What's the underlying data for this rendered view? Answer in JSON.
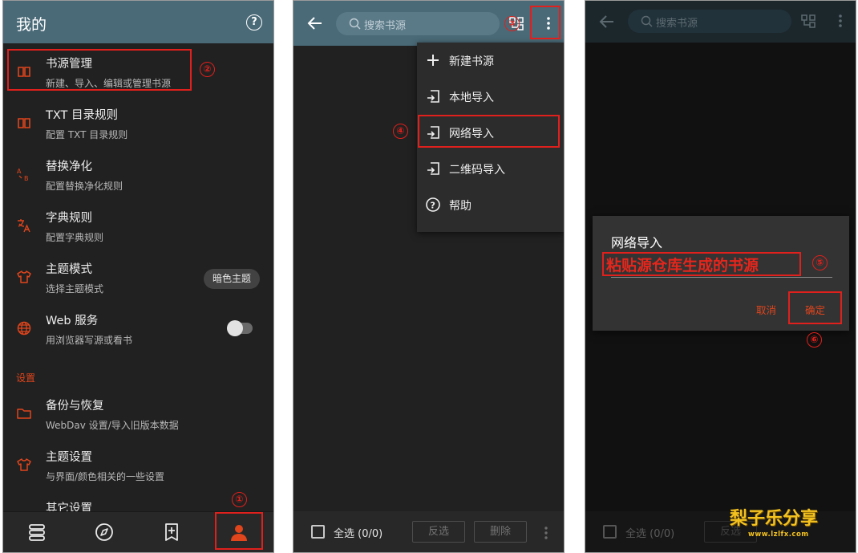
{
  "panel1": {
    "title": "我的",
    "rows": [
      {
        "title": "书源管理",
        "sub": "新建、导入、编辑或管理书源"
      },
      {
        "title": "TXT 目录规则",
        "sub": "配置 TXT 目录规则"
      },
      {
        "title": "替换净化",
        "sub": "配置替换净化规则"
      },
      {
        "title": "字典规则",
        "sub": "配置字典规则"
      },
      {
        "title": "主题模式",
        "sub": "选择主题模式"
      },
      {
        "title": "Web 服务",
        "sub": "用浏览器写源或看书"
      }
    ],
    "theme_chip": "暗色主题",
    "section_label": "设置",
    "settings_rows": [
      {
        "title": "备份与恢复",
        "sub": "WebDav 设置/导入旧版本数据"
      },
      {
        "title": "主题设置",
        "sub": "与界面/颜色相关的一些设置"
      },
      {
        "title": "其它设置",
        "sub": ""
      }
    ],
    "nav": [
      "bookshelf-icon",
      "explore-icon",
      "rss-icon",
      "profile-icon"
    ]
  },
  "panel2": {
    "search_placeholder": "搜索书源",
    "menu": [
      "新建书源",
      "本地导入",
      "网络导入",
      "二维码导入",
      "帮助"
    ],
    "select_all": "全选 (0/0)",
    "invert": "反选",
    "delete": "删除"
  },
  "panel3": {
    "search_placeholder": "搜索书源",
    "dialog_title": "网络导入",
    "dialog_input": "粘贴源仓库生成的书源",
    "cancel": "取消",
    "ok": "确定",
    "select_all": "全选 (0/0)",
    "invert": "反选"
  },
  "steps": [
    "①",
    "②",
    "③",
    "④",
    "⑤",
    "⑥"
  ],
  "watermark": {
    "text": "梨子乐分享",
    "url": "www.lzlfx.com"
  },
  "colors": {
    "accent": "#e0451c",
    "toolbar": "#4a6a78",
    "annotation": "#e0201c",
    "watermark": "#f4c21f"
  }
}
